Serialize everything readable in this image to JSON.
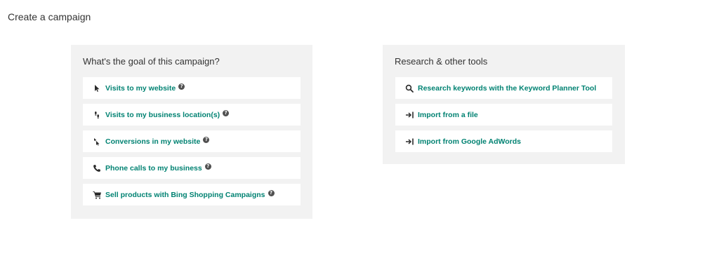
{
  "page": {
    "title": "Create a campaign"
  },
  "goal_panel": {
    "heading": "What's the goal of this campaign?",
    "options": [
      {
        "label": "Visits to my website",
        "icon": "cursor-arrow-icon",
        "help": "?"
      },
      {
        "label": "Visits to my business location(s)",
        "icon": "footsteps-icon",
        "help": "?"
      },
      {
        "label": "Conversions in my website",
        "icon": "conversion-cursor-icon",
        "help": "?"
      },
      {
        "label": "Phone calls to my business",
        "icon": "phone-icon",
        "help": "?"
      },
      {
        "label": "Sell products with Bing Shopping Campaigns",
        "icon": "shopping-cart-icon",
        "help": "?"
      }
    ]
  },
  "tools_panel": {
    "heading": "Research & other tools",
    "options": [
      {
        "label": "Research keywords with the Keyword Planner Tool",
        "icon": "search-icon"
      },
      {
        "label": "Import from a file",
        "icon": "import-icon"
      },
      {
        "label": "Import from Google AdWords",
        "icon": "import-icon"
      }
    ]
  },
  "colors": {
    "accent": "#008272",
    "panel_bg": "#f2f2f2",
    "text": "#333333"
  }
}
